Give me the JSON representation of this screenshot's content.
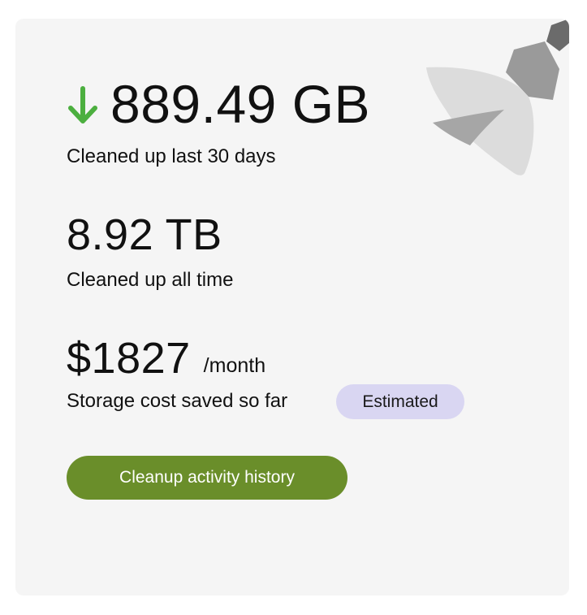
{
  "stats": {
    "last30": {
      "value": "889.49 GB",
      "label": "Cleaned up last 30 days",
      "trend_icon": "down-arrow-icon",
      "trend_color": "#4caf3f"
    },
    "alltime": {
      "value": "8.92 TB",
      "label": "Cleaned up all time"
    },
    "savings": {
      "value": "$1827",
      "unit": "/month",
      "label": "Storage cost saved so far",
      "badge": "Estimated"
    }
  },
  "actions": {
    "history_button": "Cleanup activity history"
  },
  "decoration": {
    "icon": "broom-icon"
  },
  "colors": {
    "card_bg": "#f5f5f5",
    "button_bg": "#6a8e2a",
    "badge_bg": "#d9d6f2",
    "arrow": "#4caf3f"
  }
}
